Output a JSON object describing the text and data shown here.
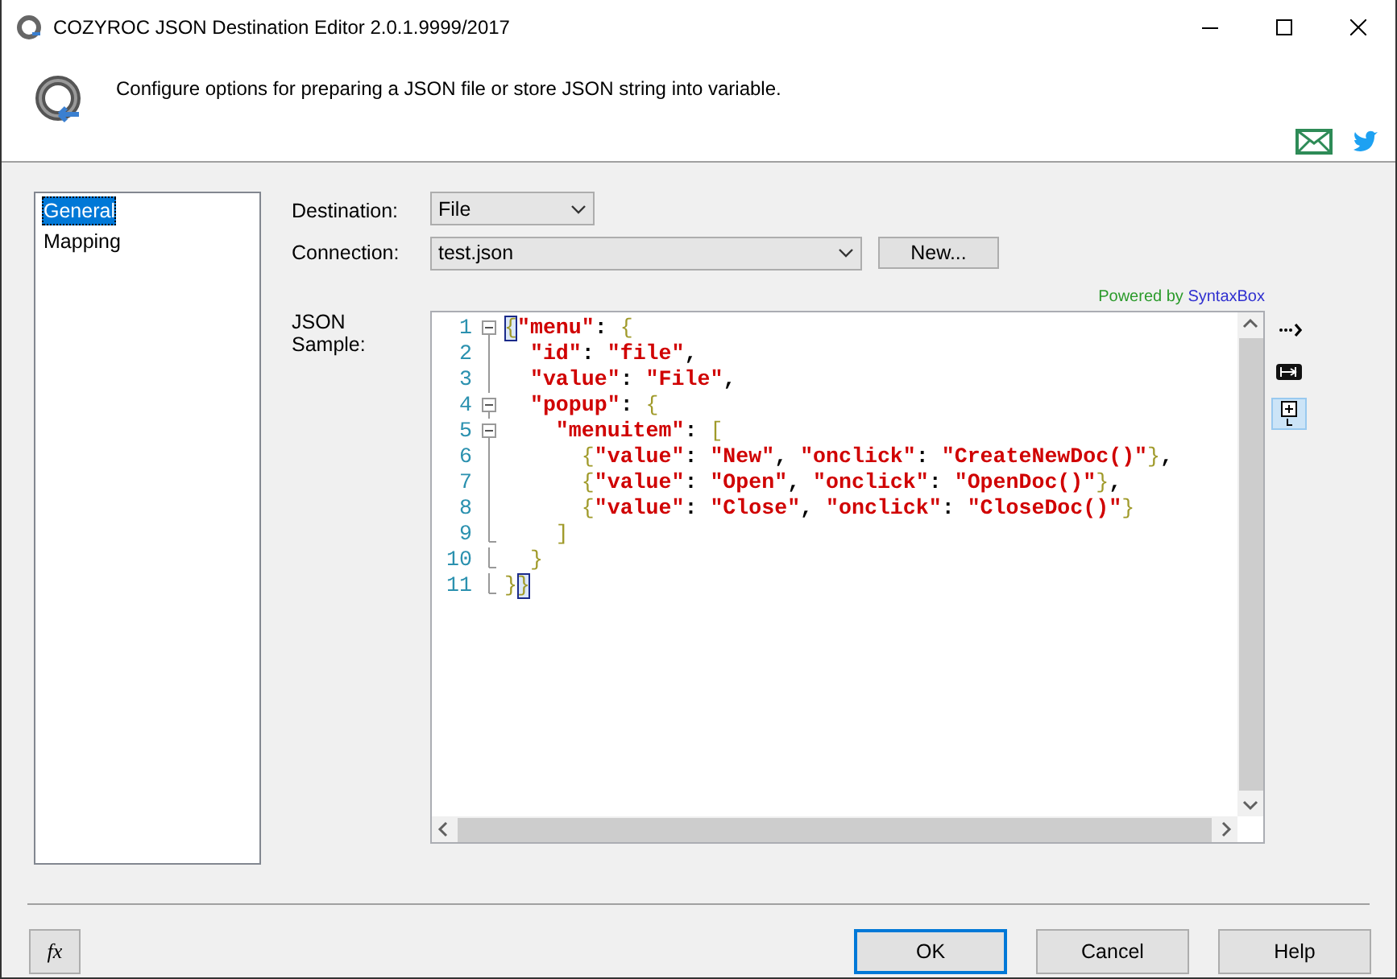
{
  "window": {
    "title": "COZYROC JSON Destination Editor 2.0.1.9999/2017"
  },
  "header": {
    "description": "Configure options for preparing a JSON file or store JSON string into variable."
  },
  "sidebar": {
    "items": [
      {
        "label": "General",
        "selected": true
      },
      {
        "label": "Mapping",
        "selected": false
      }
    ]
  },
  "destination": {
    "label": "Destination:",
    "value": "File"
  },
  "connection": {
    "label": "Connection:",
    "value": "test.json",
    "button": "New..."
  },
  "powered_by": {
    "prefix": "Powered by",
    "link": "SyntaxBox"
  },
  "json_sample": {
    "label": "JSON Sample:",
    "lines": [
      {
        "number": "1",
        "kind": "collapse",
        "tokens": [
          {
            "kind": "match",
            "text": "{"
          },
          {
            "kind": "string",
            "text": "\"menu\""
          },
          {
            "kind": "plain",
            "text": ": "
          },
          {
            "kind": "brace",
            "text": "{"
          }
        ]
      },
      {
        "number": "2",
        "kind": "line",
        "tokens": [
          {
            "kind": "string",
            "text": "  \"id\""
          },
          {
            "kind": "plain",
            "text": ": "
          },
          {
            "kind": "string",
            "text": "\"file\""
          },
          {
            "kind": "plain",
            "text": ","
          }
        ]
      },
      {
        "number": "3",
        "kind": "line",
        "tokens": [
          {
            "kind": "string",
            "text": "  \"value\""
          },
          {
            "kind": "plain",
            "text": ": "
          },
          {
            "kind": "string",
            "text": "\"File\""
          },
          {
            "kind": "plain",
            "text": ","
          }
        ]
      },
      {
        "number": "4",
        "kind": "collapse",
        "tokens": [
          {
            "kind": "string",
            "text": "  \"popup\""
          },
          {
            "kind": "plain",
            "text": ": "
          },
          {
            "kind": "brace",
            "text": "{"
          }
        ]
      },
      {
        "number": "5",
        "kind": "collapse",
        "tokens": [
          {
            "kind": "string",
            "text": "    \"menuitem\""
          },
          {
            "kind": "plain",
            "text": ": "
          },
          {
            "kind": "brace",
            "text": "["
          }
        ]
      },
      {
        "number": "6",
        "kind": "line",
        "tokens": [
          {
            "kind": "brace",
            "text": "      {"
          },
          {
            "kind": "string",
            "text": "\"value\""
          },
          {
            "kind": "plain",
            "text": ": "
          },
          {
            "kind": "string",
            "text": "\"New\""
          },
          {
            "kind": "plain",
            "text": ", "
          },
          {
            "kind": "string",
            "text": "\"onclick\""
          },
          {
            "kind": "plain",
            "text": ": "
          },
          {
            "kind": "string",
            "text": "\"CreateNewDoc()\""
          },
          {
            "kind": "brace",
            "text": "}"
          },
          {
            "kind": "plain",
            "text": ","
          }
        ]
      },
      {
        "number": "7",
        "kind": "line",
        "tokens": [
          {
            "kind": "brace",
            "text": "      {"
          },
          {
            "kind": "string",
            "text": "\"value\""
          },
          {
            "kind": "plain",
            "text": ": "
          },
          {
            "kind": "string",
            "text": "\"Open\""
          },
          {
            "kind": "plain",
            "text": ", "
          },
          {
            "kind": "string",
            "text": "\"onclick\""
          },
          {
            "kind": "plain",
            "text": ": "
          },
          {
            "kind": "string",
            "text": "\"OpenDoc()\""
          },
          {
            "kind": "brace",
            "text": "}"
          },
          {
            "kind": "plain",
            "text": ","
          }
        ]
      },
      {
        "number": "8",
        "kind": "line",
        "tokens": [
          {
            "kind": "brace",
            "text": "      {"
          },
          {
            "kind": "string",
            "text": "\"value\""
          },
          {
            "kind": "plain",
            "text": ": "
          },
          {
            "kind": "string",
            "text": "\"Close\""
          },
          {
            "kind": "plain",
            "text": ", "
          },
          {
            "kind": "string",
            "text": "\"onclick\""
          },
          {
            "kind": "plain",
            "text": ": "
          },
          {
            "kind": "string",
            "text": "\"CloseDoc()\""
          },
          {
            "kind": "brace",
            "text": "}"
          }
        ]
      },
      {
        "number": "9",
        "kind": "end",
        "tokens": [
          {
            "kind": "brace",
            "text": "    ]"
          }
        ]
      },
      {
        "number": "10",
        "kind": "end",
        "tokens": [
          {
            "kind": "brace",
            "text": "  }"
          }
        ]
      },
      {
        "number": "11",
        "kind": "end",
        "tokens": [
          {
            "kind": "brace",
            "text": "}"
          },
          {
            "kind": "match",
            "text": "}"
          }
        ]
      }
    ]
  },
  "editor_tools": [
    {
      "kind": "whitespace",
      "selected": false
    },
    {
      "kind": "tabs",
      "selected": false
    },
    {
      "kind": "folding",
      "selected": true
    }
  ],
  "buttons": [
    {
      "kind": "expression",
      "label": "fx"
    },
    {
      "kind": "default",
      "label": "OK"
    },
    {
      "kind": "normal",
      "label": "Cancel"
    },
    {
      "kind": "normal",
      "label": "Help"
    }
  ]
}
